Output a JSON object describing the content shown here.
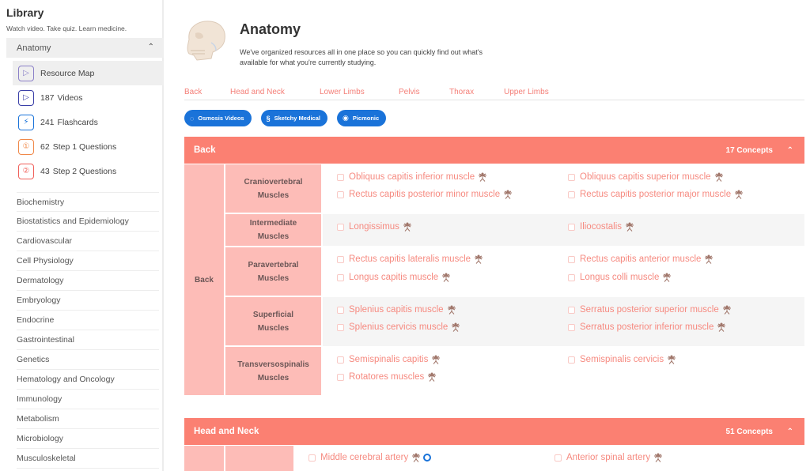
{
  "sidebar": {
    "title": "Library",
    "subtitle": "Watch video. Take quiz. Learn medicine.",
    "open_topic": "Anatomy",
    "resources": [
      {
        "icon": "resource-map-icon",
        "count": "",
        "label": "Resource Map",
        "color": "#7b6fc4"
      },
      {
        "icon": "video-play-icon",
        "count": "187",
        "label": "Videos",
        "color": "#3a3fa8"
      },
      {
        "icon": "flashcard-bolt-icon",
        "count": "241",
        "label": "Flashcards",
        "color": "#1a73d9"
      },
      {
        "icon": "step1-question-icon",
        "count": "62",
        "label": "Step 1 Questions",
        "color": "#f0894a"
      },
      {
        "icon": "step2-question-icon",
        "count": "43",
        "label": "Step 2 Questions",
        "color": "#f0605a"
      }
    ],
    "topics": [
      "Biochemistry",
      "Biostatistics and Epidemiology",
      "Cardiovascular",
      "Cell Physiology",
      "Dermatology",
      "Embryology",
      "Endocrine",
      "Gastrointestinal",
      "Genetics",
      "Hematology and Oncology",
      "Immunology",
      "Metabolism",
      "Microbiology",
      "Musculoskeletal"
    ]
  },
  "header": {
    "title": "Anatomy",
    "description": "We've organized resources all in one place so you can quickly find out what's available for what you're currently studying."
  },
  "tabs": [
    "Back",
    "Head and Neck",
    "Lower Limbs",
    "Pelvis",
    "Thorax",
    "Upper Limbs"
  ],
  "filters": [
    {
      "icon": "osmosis-icon",
      "label": "Osmosis Videos"
    },
    {
      "icon": "sketchy-icon",
      "label": "Sketchy Medical"
    },
    {
      "icon": "picmonic-icon",
      "label": "Picmonic"
    }
  ],
  "colors": {
    "accent": "#fb8072",
    "cell": "#fdbcb7",
    "link": "#f68a80",
    "filter": "#1a73d9"
  },
  "sections": [
    {
      "title": "Back",
      "concepts": "17 Concepts",
      "region": "Back",
      "groups": [
        {
          "name_line1": "Craniovertebral",
          "name_line2": "Muscles",
          "items": [
            "Obliquus capitis inferior muscle",
            "Obliquus capitis superior muscle",
            "Rectus capitis posterior minor muscle",
            "Rectus capitis posterior major muscle"
          ]
        },
        {
          "name_line1": "Intermediate",
          "name_line2": "Muscles",
          "items": [
            "Longissimus",
            "Iliocostalis"
          ]
        },
        {
          "name_line1": "Paravertebral",
          "name_line2": "Muscles",
          "items": [
            "Rectus capitis lateralis muscle",
            "Rectus capitis anterior muscle",
            "Longus capitis muscle",
            "Longus colli muscle"
          ]
        },
        {
          "name_line1": "Superficial",
          "name_line2": "Muscles",
          "items": [
            "Splenius capitis muscle",
            "Serratus posterior superior muscle",
            "Splenius cervicis muscle",
            "Serratus posterior inferior muscle"
          ]
        },
        {
          "name_line1": "Transversospinalis",
          "name_line2": "Muscles",
          "items": [
            "Semispinalis capitis",
            "Semispinalis cervicis",
            "Rotatores muscles"
          ]
        }
      ]
    },
    {
      "title": "Head and Neck",
      "concepts": "51 Concepts",
      "items": [
        "Middle cerebral artery",
        "Anterior spinal artery"
      ]
    }
  ]
}
